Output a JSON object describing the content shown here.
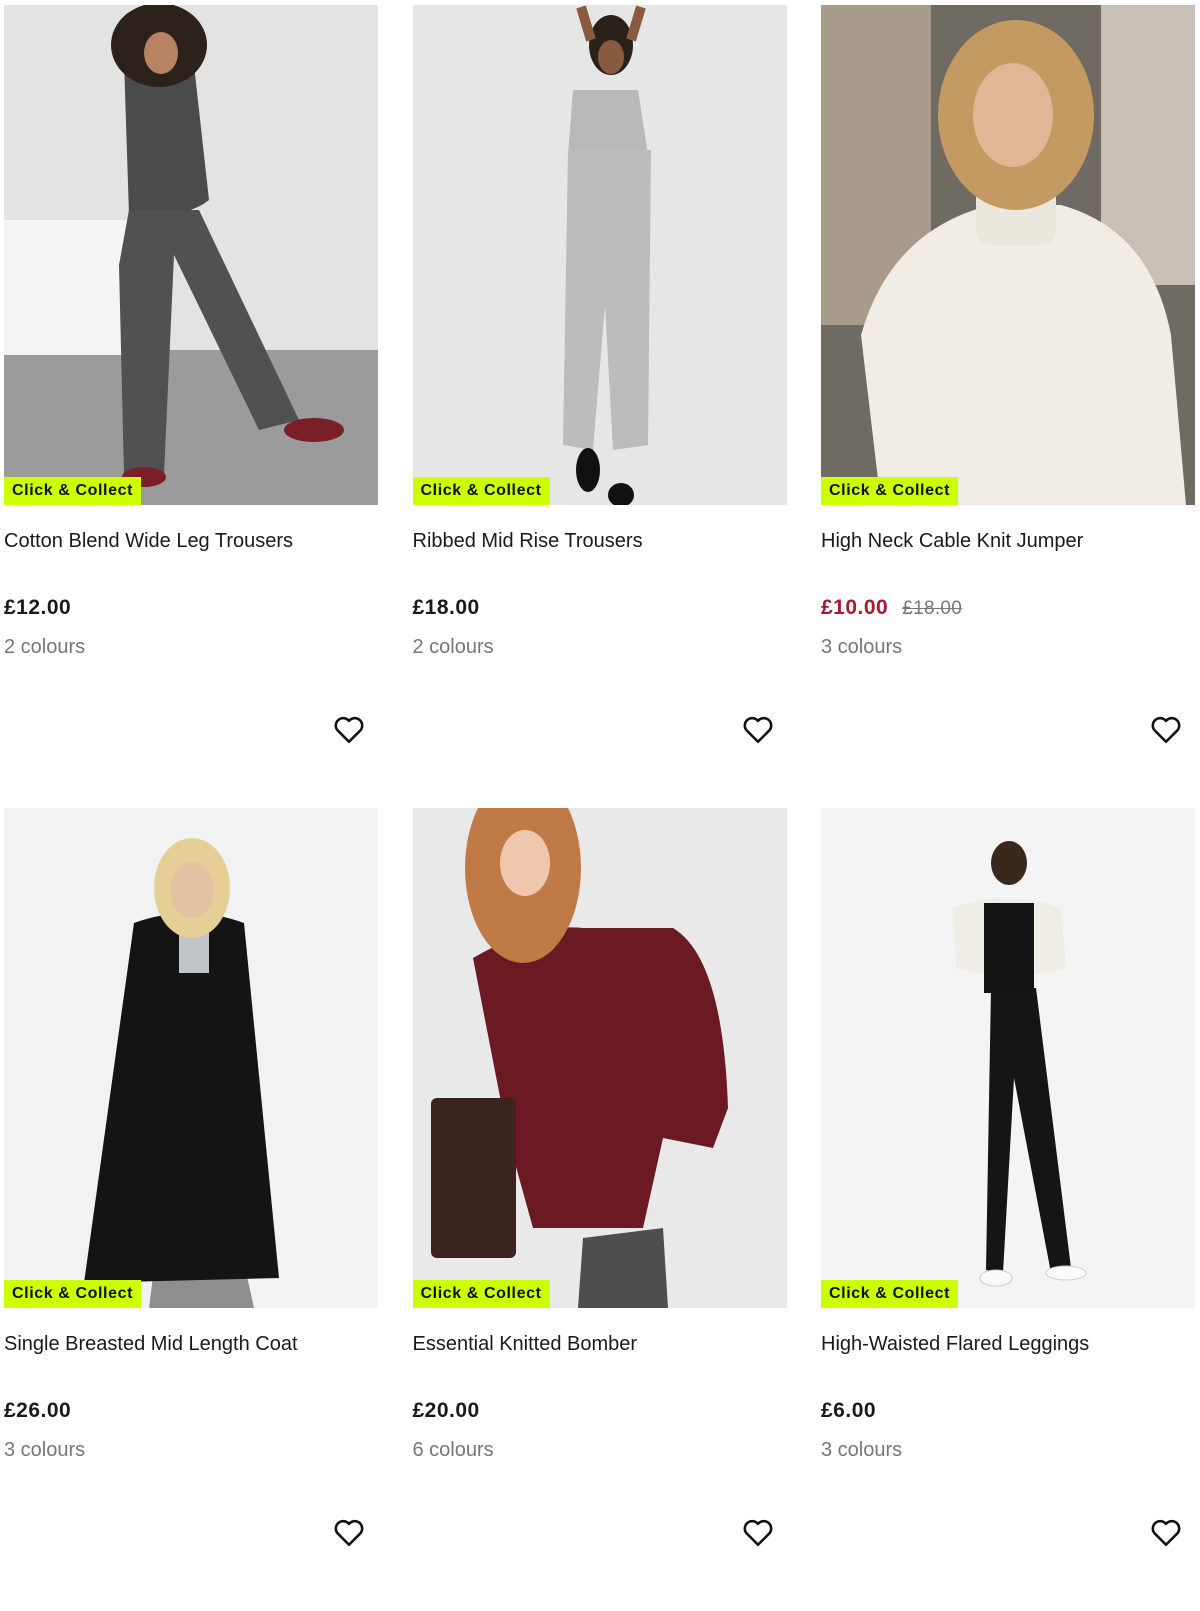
{
  "colors": {
    "badge": "#ccff00",
    "sale_price": "#a51c30",
    "muted": "#767676"
  },
  "icons": {
    "favourite": "heart-outline-icon"
  },
  "products": [
    {
      "badge": "Click & Collect",
      "name": "Cotton Blend Wide Leg Trousers",
      "price": "£12.00",
      "was_price": "",
      "colours": "2 colours"
    },
    {
      "badge": "Click & Collect",
      "name": "Ribbed Mid Rise Trousers",
      "price": "£18.00",
      "was_price": "",
      "colours": "2 colours"
    },
    {
      "badge": "Click & Collect",
      "name": "High Neck Cable Knit Jumper",
      "price": "£10.00",
      "was_price": "£18.00",
      "colours": "3 colours"
    },
    {
      "badge": "Click & Collect",
      "name": "Single Breasted Mid Length Coat",
      "price": "£26.00",
      "was_price": "",
      "colours": "3 colours"
    },
    {
      "badge": "Click & Collect",
      "name": "Essential Knitted Bomber",
      "price": "£20.00",
      "was_price": "",
      "colours": "6 colours"
    },
    {
      "badge": "Click & Collect",
      "name": "High-Waisted Flared Leggings",
      "price": "£6.00",
      "was_price": "",
      "colours": "3 colours"
    }
  ]
}
